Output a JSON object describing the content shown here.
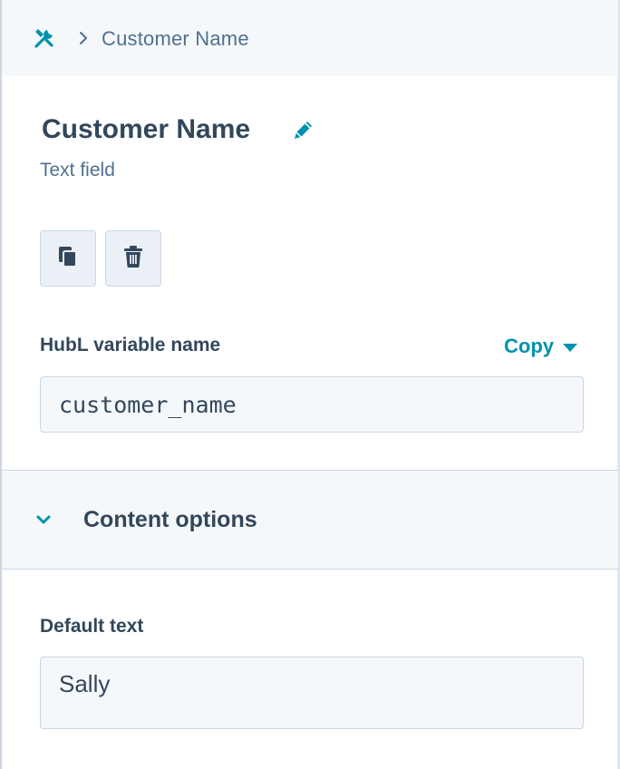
{
  "header": {
    "breadcrumb_label": "Customer Name"
  },
  "field": {
    "title": "Customer Name",
    "type_label": "Text field"
  },
  "hubl": {
    "label": "HubL variable name",
    "copy_label": "Copy",
    "value": "customer_name"
  },
  "content_options": {
    "title": "Content options",
    "default_text_label": "Default text",
    "default_text_value": "Sally"
  },
  "colors": {
    "accent": "#0091ae",
    "text": "#33475b",
    "muted": "#516f90",
    "header_bg": "#f5f8fa",
    "border": "#cbd6e2"
  },
  "icons": {
    "back": "tools-icon",
    "separator": "chevron-right-icon",
    "edit": "pencil-icon",
    "clone": "copy-icon",
    "delete": "trash-icon",
    "section": "chevron-down-icon"
  }
}
